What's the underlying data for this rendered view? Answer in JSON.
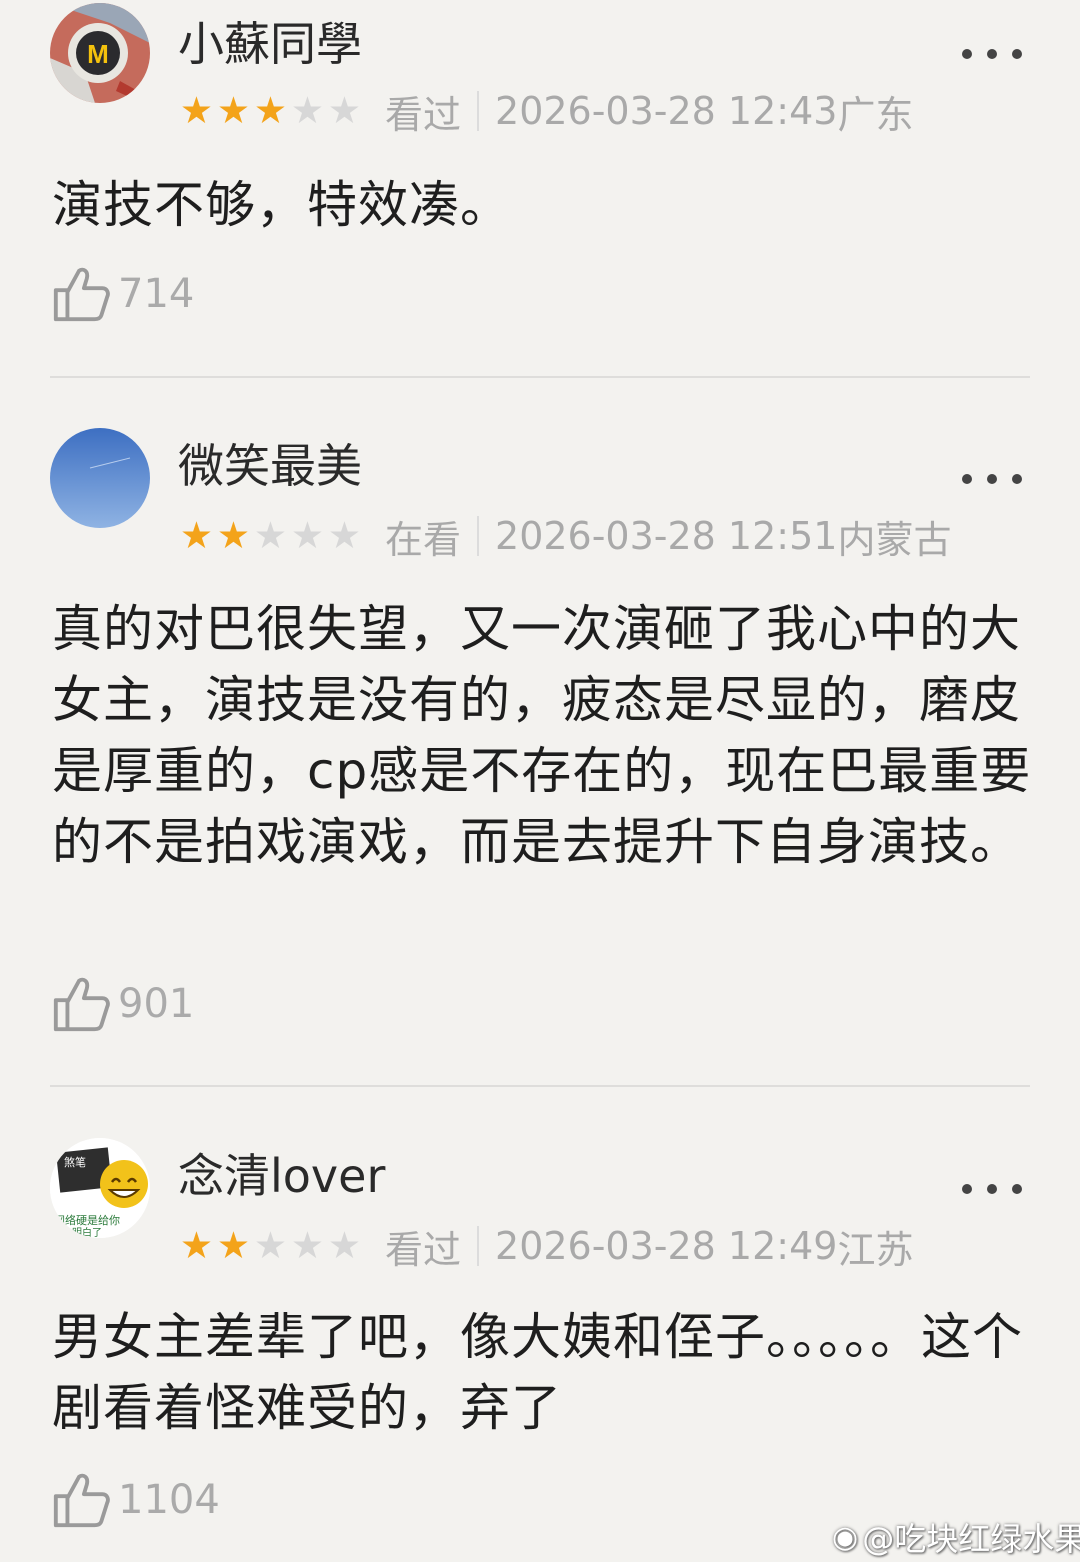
{
  "reviews": [
    {
      "username": "小蘇同學",
      "rating": 3,
      "status": "看过",
      "datetime": "2026-03-28 12:43",
      "location": "广东",
      "content": "演技不够，特效凑。",
      "likes": "714"
    },
    {
      "username": "微笑最美",
      "rating": 2,
      "status": "在看",
      "datetime": "2026-03-28 12:51",
      "location": "内蒙古",
      "content": "真的对巴很失望，又一次演砸了我心中的大女主，演技是没有的，疲态是尽显的，磨皮是厚重的，cp感是不存在的，现在巴最重要的不是拍戏演戏，而是去提升下自身演技。",
      "likes": "901"
    },
    {
      "username": "念清lover",
      "rating": 2,
      "status": "看过",
      "datetime": "2026-03-28 12:49",
      "location": "江苏",
      "content": "男女主差辈了吧，像大姨和侄子。。。。。这个剧看着怪难受的，弃了",
      "likes": "1104"
    }
  ],
  "avatar3_text": {
    "top": "煞笔",
    "bottom": "网络硬是给你",
    "bottom2": "明白了"
  },
  "watermark": {
    "text": "@吃块红绿水果"
  },
  "colors": {
    "star_on": "#f3a31a",
    "star_off": "#d7d7d7",
    "background": "#f3f2ef"
  },
  "icons": [
    "thumbs-up-icon",
    "more-dots-icon",
    "weibo-logo-icon",
    "star-icon"
  ]
}
